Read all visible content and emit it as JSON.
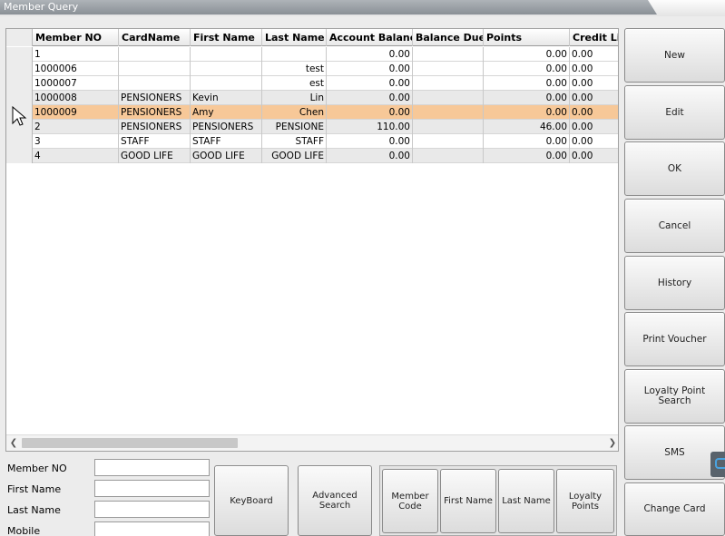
{
  "window": {
    "title": "Member Query"
  },
  "grid": {
    "columns": [
      "Member NO",
      "CardName",
      "First Name",
      "Last Name",
      "Account Balance",
      "Balance Due",
      "Points",
      "Credit Lim"
    ],
    "rows": [
      {
        "member_no": "1",
        "card_name": "",
        "first_name": "",
        "last_name": "",
        "account_balance": "0.00",
        "balance_due": "",
        "points": "0.00",
        "credit_limit": "0.00"
      },
      {
        "member_no": "1000006",
        "card_name": "",
        "first_name": "",
        "last_name": "test",
        "account_balance": "0.00",
        "balance_due": "",
        "points": "0.00",
        "credit_limit": "0.00"
      },
      {
        "member_no": "1000007",
        "card_name": "",
        "first_name": "",
        "last_name": "est",
        "account_balance": "0.00",
        "balance_due": "",
        "points": "0.00",
        "credit_limit": "0.00"
      },
      {
        "member_no": "1000008",
        "card_name": "PENSIONERS",
        "first_name": "Kevin",
        "last_name": "Lin",
        "account_balance": "0.00",
        "balance_due": "",
        "points": "0.00",
        "credit_limit": "0.00"
      },
      {
        "member_no": "1000009",
        "card_name": "PENSIONERS",
        "first_name": "Amy",
        "last_name": "Chen",
        "account_balance": "0.00",
        "balance_due": "",
        "points": "0.00",
        "credit_limit": "0.00"
      },
      {
        "member_no": "2",
        "card_name": "PENSIONERS",
        "first_name": "PENSIONERS",
        "last_name": "PENSIONE",
        "account_balance": "110.00",
        "balance_due": "",
        "points": "46.00",
        "credit_limit": "0.00"
      },
      {
        "member_no": "3",
        "card_name": "STAFF",
        "first_name": "STAFF",
        "last_name": "STAFF",
        "account_balance": "0.00",
        "balance_due": "",
        "points": "0.00",
        "credit_limit": "0.00"
      },
      {
        "member_no": "4",
        "card_name": "GOOD LIFE",
        "first_name": "GOOD LIFE",
        "last_name": "GOOD LIFE",
        "account_balance": "0.00",
        "balance_due": "",
        "points": "0.00",
        "credit_limit": "0.00"
      }
    ],
    "selected_row": 4
  },
  "filters": {
    "member_no_label": "Member NO",
    "first_name_label": "First Name",
    "last_name_label": "Last Name",
    "mobile_label": "Mobile",
    "member_no_value": "",
    "first_name_value": "",
    "last_name_value": "",
    "mobile_value": ""
  },
  "bottom_buttons": {
    "keyboard": "KeyBoard",
    "advanced_search": "Advanced Search"
  },
  "sort_buttons": {
    "member_code": "Member Code",
    "first_name": "First Name",
    "last_name": "Last Name",
    "loyalty_points": "Loyalty Points"
  },
  "side_buttons": {
    "new": "New",
    "edit": "Edit",
    "ok": "OK",
    "cancel": "Cancel",
    "history": "History",
    "print_voucher": "Print Voucher",
    "loyalty_point_search": "Loyalty Point Search",
    "sms": "SMS",
    "change_card": "Change Card"
  },
  "icons": {
    "scroll_left": "scroll-left-icon",
    "scroll_right": "scroll-right-icon",
    "row_pointer": "row-pointer-icon",
    "mouse_cursor": "mouse-cursor-icon"
  },
  "colors": {
    "selected_row": "#f7c898",
    "alt_row": "#e9e9e9",
    "title_bar": "#8a9096"
  }
}
